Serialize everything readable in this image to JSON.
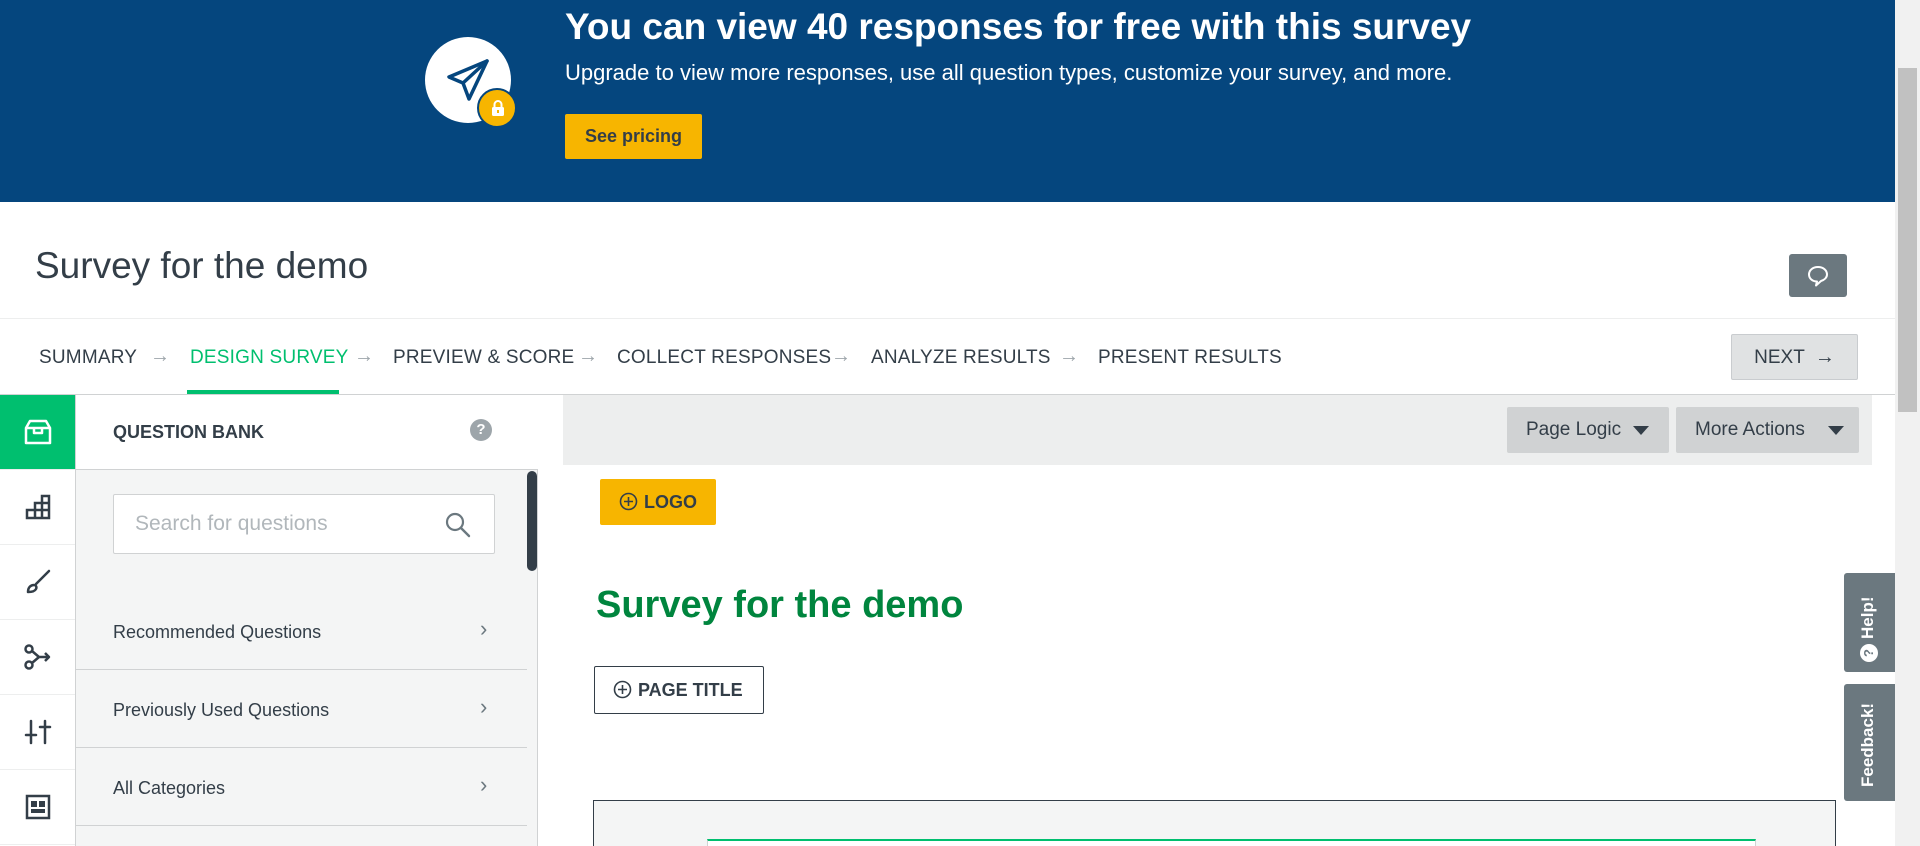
{
  "banner": {
    "title": "You can view 40 responses for free with this survey",
    "subtitle": "Upgrade to view more responses, use all question types, customize your survey, and more.",
    "pricing_label": "See pricing",
    "icon": "paper-plane-icon",
    "badge_icon": "lock-icon"
  },
  "header": {
    "survey_name": "Survey for the demo",
    "comment_icon": "comment-icon"
  },
  "steps": {
    "items": [
      "SUMMARY",
      "DESIGN SURVEY",
      "PREVIEW & SCORE",
      "COLLECT RESPONSES",
      "ANALYZE RESULTS",
      "PRESENT RESULTS"
    ],
    "active": "DESIGN SURVEY",
    "next_label": "NEXT",
    "arrow": "→"
  },
  "rail": {
    "icons": [
      "question-bank-icon",
      "builder-icon",
      "style-icon",
      "logic-icon",
      "options-icon",
      "layout-icon"
    ],
    "active": "question-bank-icon"
  },
  "question_bank": {
    "title": "QUESTION BANK",
    "help": "?",
    "search_placeholder": "Search for questions",
    "search_value": "",
    "rows": [
      "Recommended Questions",
      "Previously Used Questions",
      "All Categories"
    ],
    "chevron": "›"
  },
  "toolbar": {
    "page_logic": "Page Logic",
    "more_actions": "More Actions"
  },
  "canvas": {
    "logo_label": "LOGO",
    "survey_title": "Survey for the demo",
    "page_title_label": "PAGE TITLE"
  },
  "side_tabs": {
    "help": "Help!",
    "feedback": "Feedback!"
  },
  "colors": {
    "banner": "#05467e",
    "accent_green": "#00bf6f",
    "title_green": "#00853e",
    "yellow": "#f7b500",
    "dark_text": "#333e48",
    "gray_button": "#6b787f"
  }
}
